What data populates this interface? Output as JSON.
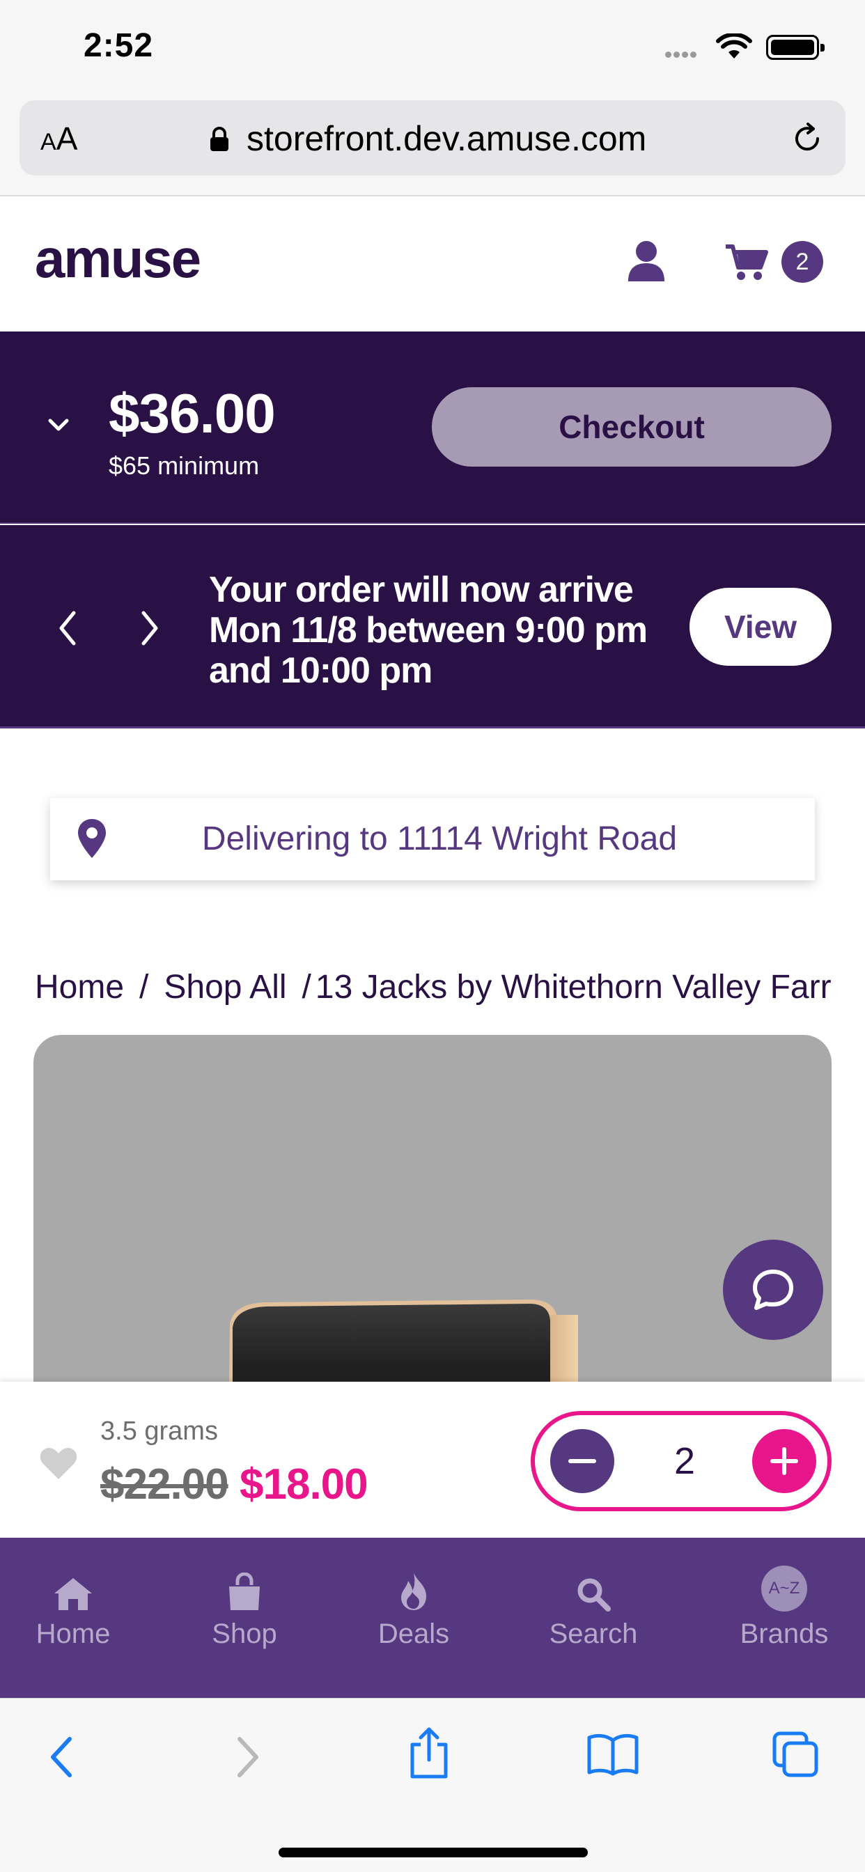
{
  "status_bar": {
    "time": "2:52"
  },
  "browser": {
    "text_size_label_small": "A",
    "text_size_label_large": "A",
    "url": "storefront.dev.amuse.com"
  },
  "header": {
    "logo_text": "amuse",
    "cart_count": "2"
  },
  "cart_summary": {
    "total": "$36.00",
    "minimum": "$65 minimum",
    "checkout_label": "Checkout"
  },
  "delivery_banner": {
    "message": "Your order will now arrive Mon 11/8 between 9:00 pm and 10:00 pm",
    "view_label": "View"
  },
  "delivery_address": {
    "text": "Delivering to 11114 Wright Road"
  },
  "breadcrumb": {
    "items": [
      "Home",
      "Shop All",
      "13 Jacks by Whitethorn Valley Farr"
    ],
    "separator": "/"
  },
  "product": {
    "weight": "3.5 grams",
    "original_price": "$22.00",
    "sale_price": "$18.00",
    "quantity": "2"
  },
  "bottom_nav": {
    "items": [
      {
        "label": "Home",
        "icon": "home-icon"
      },
      {
        "label": "Shop",
        "icon": "shopping-bag-icon"
      },
      {
        "label": "Deals",
        "icon": "flame-icon"
      },
      {
        "label": "Search",
        "icon": "search-icon"
      },
      {
        "label": "Brands",
        "icon": "a-z-icon",
        "icon_text": "A~Z"
      }
    ]
  },
  "colors": {
    "brand_dark": "#2a1145",
    "brand_purple": "#55387f",
    "accent_pink": "#e8168a",
    "checkout_disabled": "#a69ab4",
    "safari_blue": "#1a7cf5"
  }
}
